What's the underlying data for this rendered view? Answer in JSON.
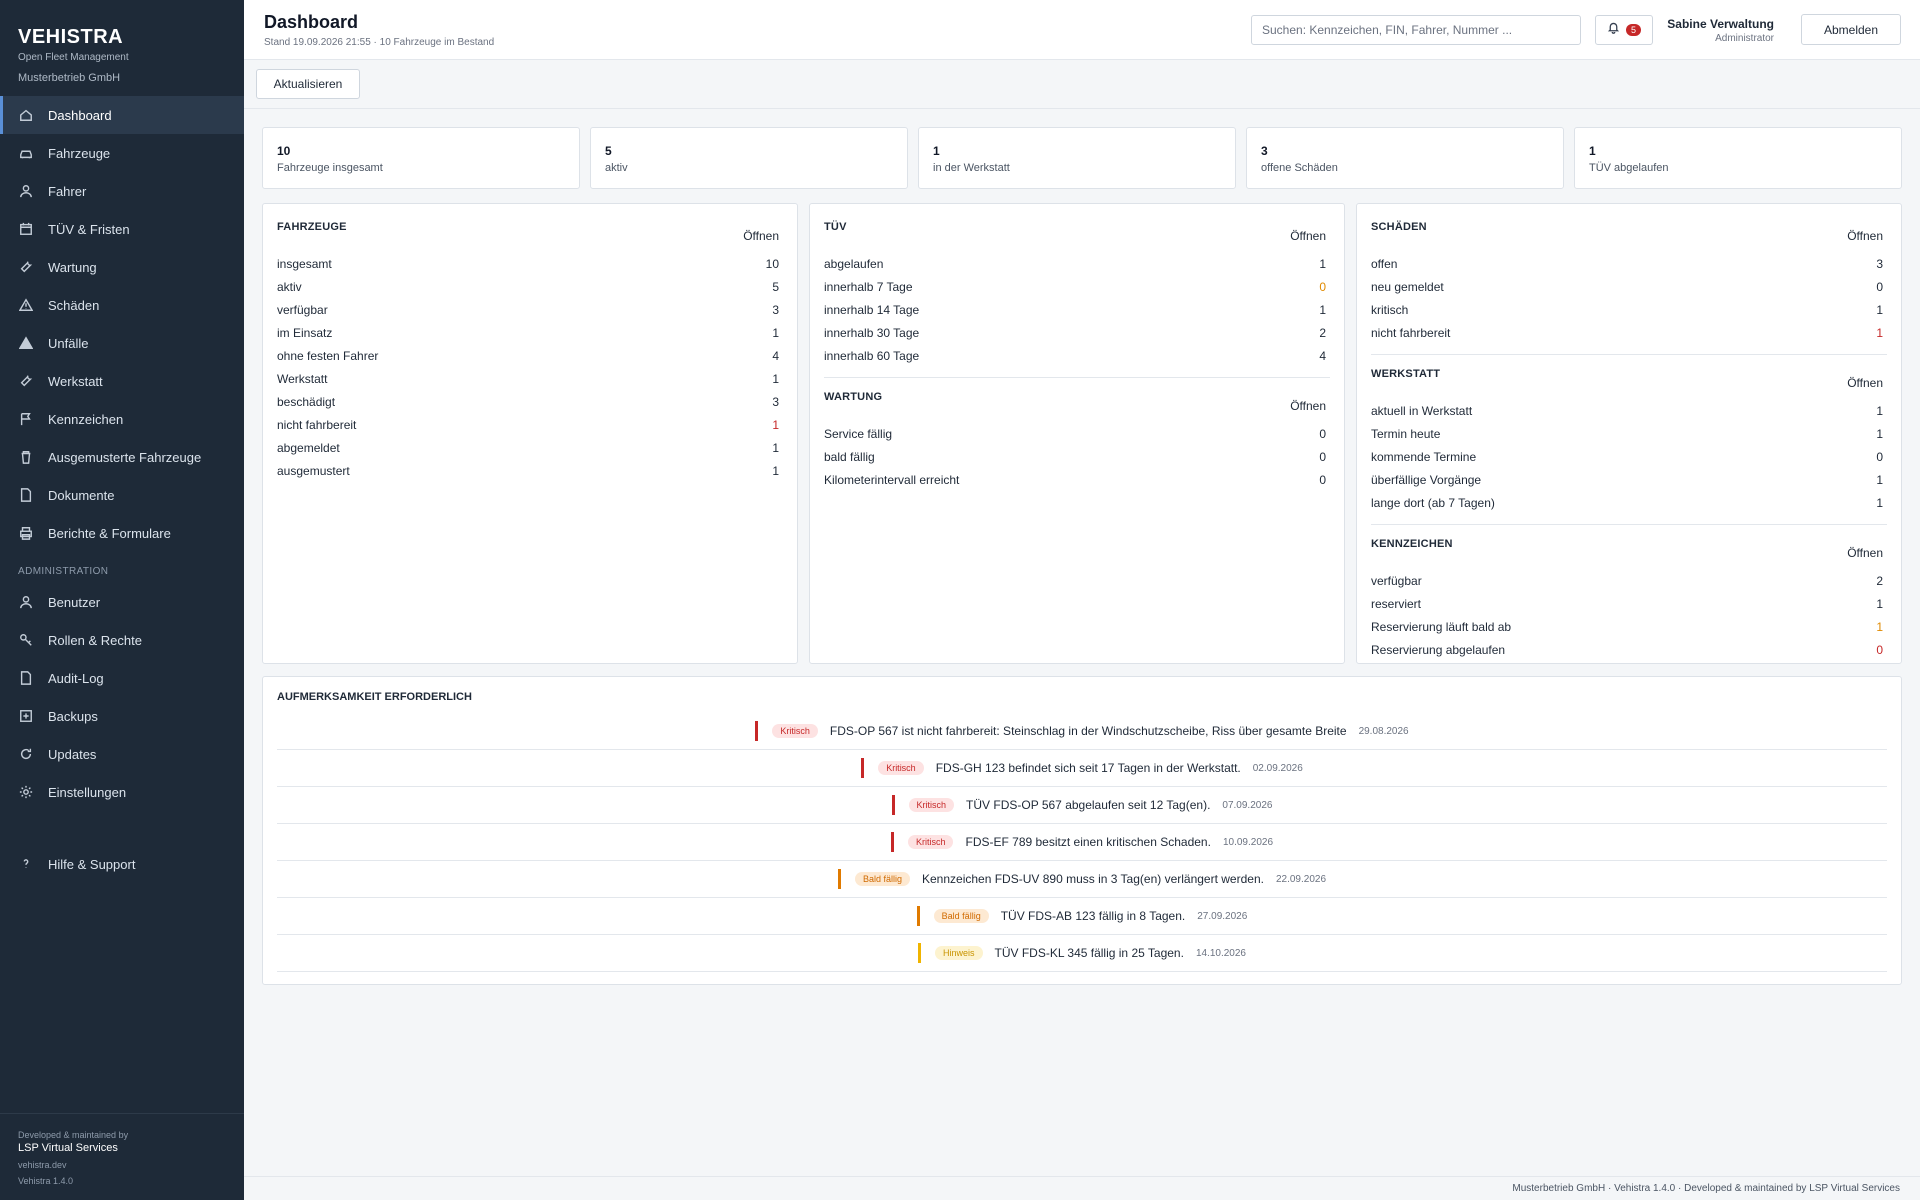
{
  "brand": {
    "name": "VEHISTRA",
    "subtitle": "Open Fleet Management",
    "company": "Musterbetrieb GmbH"
  },
  "nav": [
    {
      "label": "Dashboard",
      "icon": "home-icon",
      "active": true
    },
    {
      "label": "Fahrzeuge",
      "icon": "car-icon"
    },
    {
      "label": "Fahrer",
      "icon": "user-icon"
    },
    {
      "label": "TÜV & Fristen",
      "icon": "calendar-icon"
    },
    {
      "label": "Wartung",
      "icon": "wrench-icon"
    },
    {
      "label": "Schäden",
      "icon": "warning-icon"
    },
    {
      "label": "Unfälle",
      "icon": "alert-filled-icon"
    },
    {
      "label": "Werkstatt",
      "icon": "wrench-icon"
    },
    {
      "label": "Kennzeichen",
      "icon": "flag-icon"
    },
    {
      "label": "Ausgemusterte Fahrzeuge",
      "icon": "trash-icon"
    },
    {
      "label": "Dokumente",
      "icon": "document-icon"
    },
    {
      "label": "Berichte & Formulare",
      "icon": "printer-icon"
    }
  ],
  "admin_section": "ADMINISTRATION",
  "admin_nav": [
    {
      "label": "Benutzer",
      "icon": "user-icon"
    },
    {
      "label": "Rollen & Rechte",
      "icon": "key-icon"
    },
    {
      "label": "Audit-Log",
      "icon": "document-icon"
    },
    {
      "label": "Backups",
      "icon": "backup-icon"
    },
    {
      "label": "Updates",
      "icon": "refresh-icon"
    },
    {
      "label": "Einstellungen",
      "icon": "gear-icon"
    }
  ],
  "help": {
    "label": "Hilfe & Support",
    "icon": "help-icon"
  },
  "sidebar_footer": {
    "dev": "Developed & maintained by",
    "company": "LSP Virtual Services",
    "url": "vehistra.dev",
    "version": "Vehistra 1.4.0"
  },
  "header": {
    "title": "Dashboard",
    "subtitle": "Stand 19.09.2026 21:55 · 10 Fahrzeuge im Bestand",
    "search_placeholder": "Suchen: Kennzeichen, FIN, Fahrer, Nummer ...",
    "notification_count": "5",
    "user_name": "Sabine Verwaltung",
    "user_role": "Administrator",
    "logout": "Abmelden"
  },
  "toolbar": {
    "refresh": "Aktualisieren"
  },
  "stats": [
    {
      "value": "10",
      "label": "Fahrzeuge insgesamt"
    },
    {
      "value": "5",
      "label": "aktiv"
    },
    {
      "value": "1",
      "label": "in der Werkstatt"
    },
    {
      "value": "3",
      "label": "offene Schäden"
    },
    {
      "value": "1",
      "label": "TÜV abgelaufen"
    }
  ],
  "open_label": "Öffnen",
  "fahrzeuge": {
    "title": "FAHRZEUGE",
    "rows": [
      {
        "label": "insgesamt",
        "value": "10"
      },
      {
        "label": "aktiv",
        "value": "5"
      },
      {
        "label": "verfügbar",
        "value": "3"
      },
      {
        "label": "im Einsatz",
        "value": "1"
      },
      {
        "label": "ohne festen Fahrer",
        "value": "4"
      },
      {
        "label": "Werkstatt",
        "value": "1"
      },
      {
        "label": "beschädigt",
        "value": "3"
      },
      {
        "label": "nicht fahrbereit",
        "value": "1",
        "color": "#c62828"
      },
      {
        "label": "abgemeldet",
        "value": "1"
      },
      {
        "label": "ausgemustert",
        "value": "1"
      }
    ]
  },
  "tuev": {
    "title": "TÜV",
    "rows": [
      {
        "label": "abgelaufen",
        "value": "1"
      },
      {
        "label": "innerhalb 7 Tage",
        "value": "0",
        "color": "#e08a00"
      },
      {
        "label": "innerhalb 14 Tage",
        "value": "1"
      },
      {
        "label": "innerhalb 30 Tage",
        "value": "2"
      },
      {
        "label": "innerhalb 60 Tage",
        "value": "4"
      }
    ]
  },
  "wartung": {
    "title": "WARTUNG",
    "rows": [
      {
        "label": "Service fällig",
        "value": "0"
      },
      {
        "label": "bald fällig",
        "value": "0"
      },
      {
        "label": "Kilometerintervall erreicht",
        "value": "0"
      }
    ]
  },
  "schaeden": {
    "title": "SCHÄDEN",
    "rows": [
      {
        "label": "offen",
        "value": "3"
      },
      {
        "label": "neu gemeldet",
        "value": "0"
      },
      {
        "label": "kritisch",
        "value": "1"
      },
      {
        "label": "nicht fahrbereit",
        "value": "1",
        "color": "#c62828"
      }
    ]
  },
  "werkstatt": {
    "title": "WERKSTATT",
    "rows": [
      {
        "label": "aktuell in Werkstatt",
        "value": "1"
      },
      {
        "label": "Termin heute",
        "value": "1"
      },
      {
        "label": "kommende Termine",
        "value": "0"
      },
      {
        "label": "überfällige Vorgänge",
        "value": "1"
      },
      {
        "label": "lange dort (ab 7 Tagen)",
        "value": "1"
      }
    ]
  },
  "kennzeichen": {
    "title": "KENNZEICHEN",
    "rows": [
      {
        "label": "verfügbar",
        "value": "2"
      },
      {
        "label": "reserviert",
        "value": "1"
      },
      {
        "label": "Reservierung läuft bald ab",
        "value": "1",
        "color": "#e08a00"
      },
      {
        "label": "Reservierung abgelaufen",
        "value": "0",
        "color": "#c62828"
      }
    ]
  },
  "attention": {
    "title": "AUFMERKSAMKEIT ERFORDERLICH",
    "items": [
      {
        "level": "Kritisch",
        "text": "FDS-OP 567 ist nicht fahrbereit: Steinschlag in der Windschutzscheibe, Riss über gesamte Breite",
        "date": "29.08.2026",
        "bar": "#c62828",
        "badge_bg": "#fde2e2",
        "badge_fg": "#c62828"
      },
      {
        "level": "Kritisch",
        "text": "FDS-GH 123 befindet sich seit 17 Tagen in der Werkstatt.",
        "date": "02.09.2026",
        "bar": "#c62828",
        "badge_bg": "#fde2e2",
        "badge_fg": "#c62828"
      },
      {
        "level": "Kritisch",
        "text": "TÜV FDS-OP 567 abgelaufen seit 12 Tag(en).",
        "date": "07.09.2026",
        "bar": "#c62828",
        "badge_bg": "#fde2e2",
        "badge_fg": "#c62828"
      },
      {
        "level": "Kritisch",
        "text": "FDS-EF 789 besitzt einen kritischen Schaden.",
        "date": "10.09.2026",
        "bar": "#c62828",
        "badge_bg": "#fde2e2",
        "badge_fg": "#c62828"
      },
      {
        "level": "Bald fällig",
        "text": "Kennzeichen FDS-UV 890 muss in 3 Tag(en) verlängert werden.",
        "date": "22.09.2026",
        "bar": "#e07a00",
        "badge_bg": "#fde9d2",
        "badge_fg": "#d06a00"
      },
      {
        "level": "Bald fällig",
        "text": "TÜV FDS-AB 123 fällig in 8 Tagen.",
        "date": "27.09.2026",
        "bar": "#e07a00",
        "badge_bg": "#fde9d2",
        "badge_fg": "#d06a00"
      },
      {
        "level": "Hinweis",
        "text": "TÜV FDS-KL 345 fällig in 25 Tagen.",
        "date": "14.10.2026",
        "bar": "#f0b400",
        "badge_bg": "#fdf3cf",
        "badge_fg": "#c99400"
      }
    ]
  },
  "footer": "Musterbetrieb GmbH · Vehistra 1.4.0 · Developed & maintained by LSP Virtual Services"
}
